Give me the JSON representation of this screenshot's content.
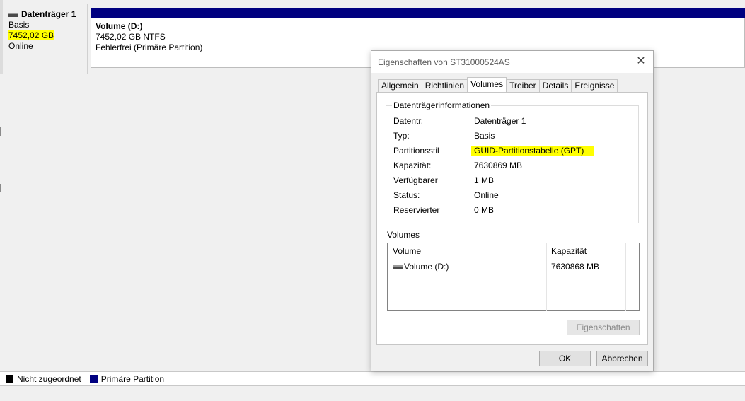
{
  "disk": {
    "title": "Datenträger 1",
    "type": "Basis",
    "size": "7452,02 GB",
    "state": "Online"
  },
  "volume": {
    "name": "Volume  (D:)",
    "size_fs": "7452,02 GB NTFS",
    "status": "Fehlerfrei (Primäre Partition)",
    "bar_color": "#000080"
  },
  "legend": {
    "items": [
      {
        "label": "Nicht zugeordnet",
        "color": "#000000"
      },
      {
        "label": "Primäre Partition",
        "color": "#000080"
      }
    ]
  },
  "dialog": {
    "title": "Eigenschaften von ST31000524AS",
    "close_icon": "close-icon",
    "tabs": [
      {
        "label": "Allgemein"
      },
      {
        "label": "Richtlinien"
      },
      {
        "label": "Volumes",
        "active": true
      },
      {
        "label": "Treiber"
      },
      {
        "label": "Details"
      },
      {
        "label": "Ereignisse"
      }
    ],
    "group_title": "Datenträgerinformationen",
    "info": [
      {
        "label": "Datentr.",
        "value": "Datenträger 1"
      },
      {
        "label": "Typ:",
        "value": "Basis"
      },
      {
        "label": "Partitionsstil",
        "value": "GUID-Partitionstabelle (GPT)"
      },
      {
        "label": "Kapazität:",
        "value": "7630869 MB"
      },
      {
        "label": "Verfügbarer",
        "value": "1 MB"
      },
      {
        "label": "Status:",
        "value": "Online"
      },
      {
        "label": "Reservierter",
        "value": "0 MB"
      }
    ],
    "volumes_label": "Volumes",
    "list_headers": {
      "volume": "Volume",
      "capacity": "Kapazität"
    },
    "list_rows": [
      {
        "volume": "Volume (D:)",
        "capacity": "7630868 MB"
      }
    ],
    "properties_button": "Eigenschaften",
    "ok_button": "OK",
    "cancel_button": "Abbrechen"
  },
  "highlight_color": "#ffff00"
}
